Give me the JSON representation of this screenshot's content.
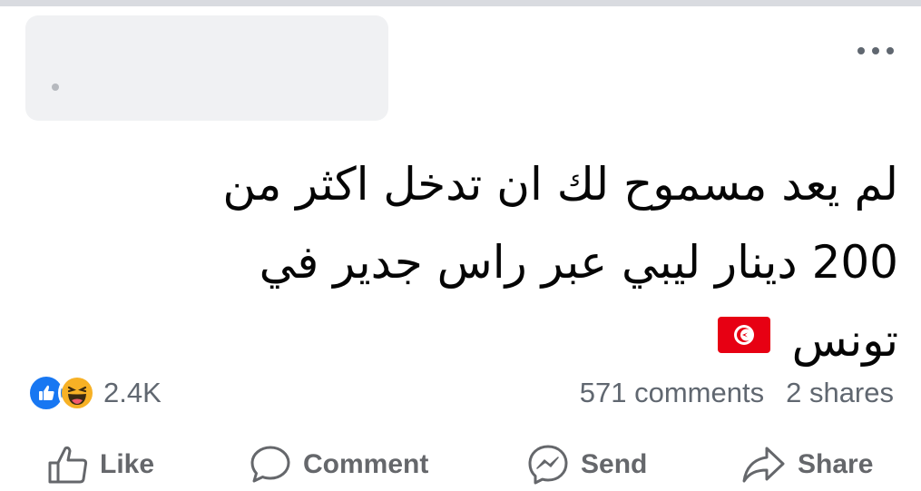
{
  "post": {
    "lines": [
      "لم يعد مسموح لك ان تدخل اكثر من",
      "200 دينار ليبي عبر راس جدير في",
      "تونس"
    ],
    "flag_icon": "tunisia-flag-icon"
  },
  "reactions": {
    "icons": [
      "like-reaction-icon",
      "haha-reaction-icon"
    ],
    "count": "2.4K"
  },
  "stats": {
    "comments": "571 comments",
    "shares": "2 shares"
  },
  "actions": {
    "like": "Like",
    "comment": "Comment",
    "send": "Send",
    "share": "Share"
  },
  "colors": {
    "like_blue": "#1877f2",
    "haha_yellow": "#f7b125",
    "tunisia_red": "#e70013",
    "muted_text": "#65676b"
  }
}
